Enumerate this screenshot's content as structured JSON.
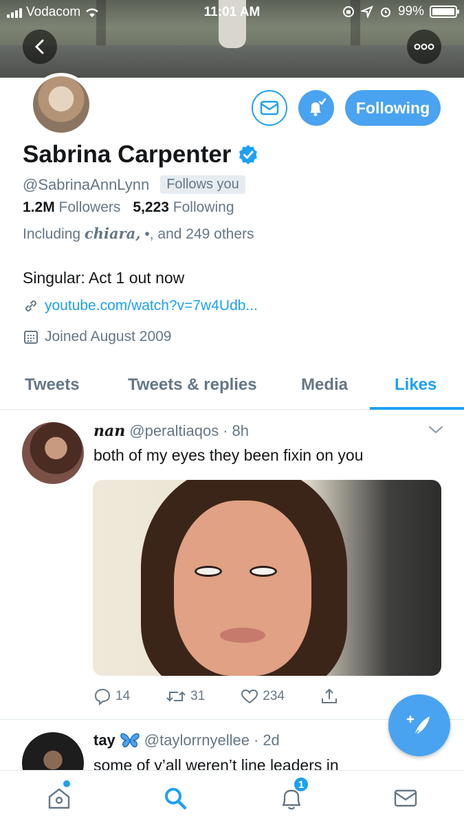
{
  "status_bar": {
    "carrier": "Vodacom",
    "time": "11:01 AM",
    "battery": "99%"
  },
  "profile": {
    "name": "Sabrina Carpenter",
    "handle": "@SabrinaAnnLynn",
    "follows_you": "Follows you",
    "followers_count": "1.2M",
    "followers_label": "Followers",
    "following_count": "5,223",
    "following_label": "Following",
    "including_prefix": "Including",
    "including_name": "chiara,",
    "including_mid": "•, ",
    "including_suffix": "and 249 others",
    "bio": "Singular: Act 1 out now",
    "link": "youtube.com/watch?v=7w4Udb...",
    "joined": "Joined August 2009",
    "follow_button": "Following"
  },
  "tabs": [
    {
      "label": "Tweets"
    },
    {
      "label": "Tweets & replies"
    },
    {
      "label": "Media"
    },
    {
      "label": "Likes"
    }
  ],
  "active_tab": "Likes",
  "tweets": [
    {
      "name": "nan",
      "handle": "@peraltiaqos",
      "time": "8h",
      "text": "both of my eyes they been fixin on you",
      "replies": "14",
      "retweets": "31",
      "likes": "234"
    },
    {
      "name": "tay",
      "emoji": "🦋",
      "handle": "@taylorrnyellee",
      "time": "2d",
      "text": "some of y’all weren’t line leaders in"
    }
  ],
  "bottom_nav": {
    "notifications_badge": "1"
  },
  "colors": {
    "accent": "#1da1f2",
    "button_blue": "#4aa3f0",
    "secondary_text": "#657786"
  }
}
